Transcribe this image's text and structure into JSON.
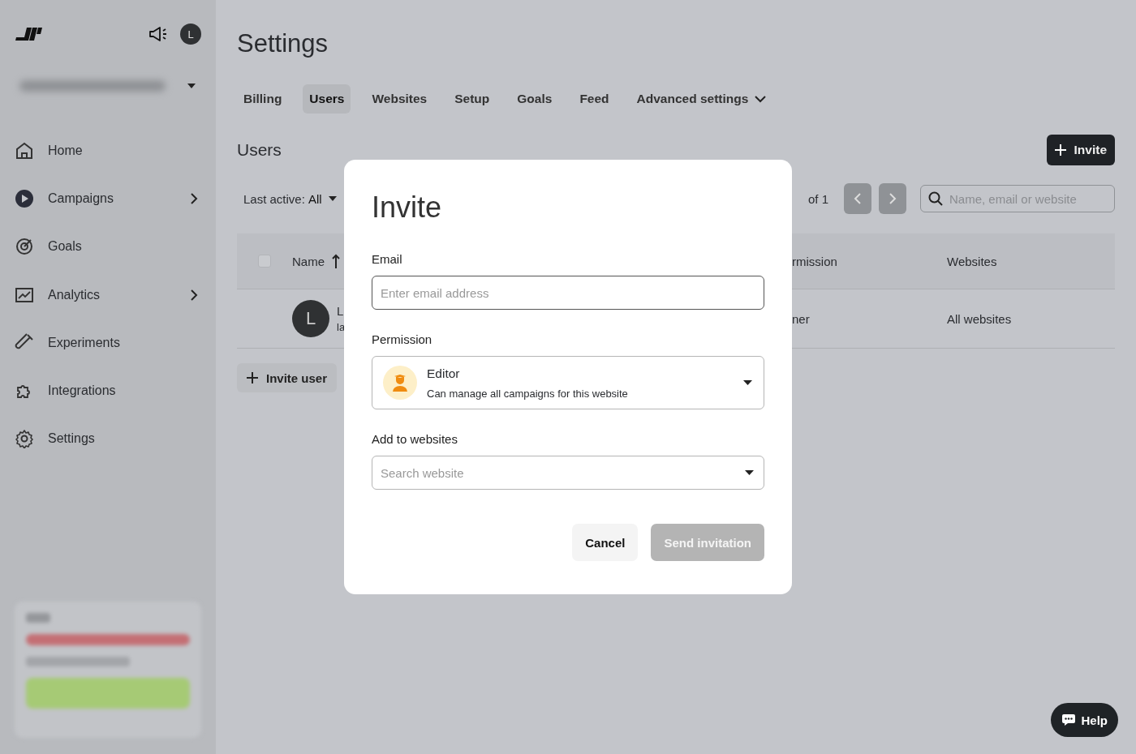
{
  "sidebar": {
    "avatar": "L",
    "nav": [
      {
        "label": "Home",
        "has_submenu": false
      },
      {
        "label": "Campaigns",
        "has_submenu": true
      },
      {
        "label": "Goals",
        "has_submenu": false
      },
      {
        "label": "Analytics",
        "has_submenu": true
      },
      {
        "label": "Experiments",
        "has_submenu": false
      },
      {
        "label": "Integrations",
        "has_submenu": false
      },
      {
        "label": "Settings",
        "has_submenu": false
      }
    ]
  },
  "page": {
    "title": "Settings",
    "tabs": [
      {
        "label": "Billing",
        "kind": "tab",
        "selected": false
      },
      {
        "label": "Users",
        "kind": "tab",
        "selected": true
      },
      {
        "label": "Websites",
        "kind": "tab",
        "selected": false
      },
      {
        "label": "Setup",
        "kind": "tab",
        "selected": false
      },
      {
        "label": "Goals",
        "kind": "tab",
        "selected": false
      },
      {
        "label": "Feed",
        "kind": "tab",
        "selected": false
      },
      {
        "label": "Advanced settings",
        "kind": "dropdown",
        "selected": false
      }
    ],
    "section_title": "Users",
    "invite_button": "Invite",
    "filter": {
      "label": "Last active:",
      "value": "All"
    },
    "pagination": "of 1",
    "search": {
      "placeholder": "Name, email or website"
    },
    "table": {
      "select_all_checked": false,
      "columns": [
        "Name",
        "rmission",
        "Websites"
      ],
      "rows": [
        {
          "avatar": "L",
          "name": "L",
          "email": "la",
          "permission": "ner",
          "websites": "All websites"
        }
      ]
    },
    "invite_user_button": "Invite user"
  },
  "modal": {
    "title": "Invite",
    "email": {
      "label": "Email",
      "placeholder": "Enter email address"
    },
    "permission": {
      "label": "Permission",
      "role": "Editor",
      "description": "Can manage all campaigns for this website"
    },
    "websites": {
      "label": "Add to websites",
      "placeholder": "Search website"
    },
    "cancel": "Cancel",
    "submit": {
      "label": "Send invitation",
      "disabled": true
    }
  },
  "help_button": "Help"
}
